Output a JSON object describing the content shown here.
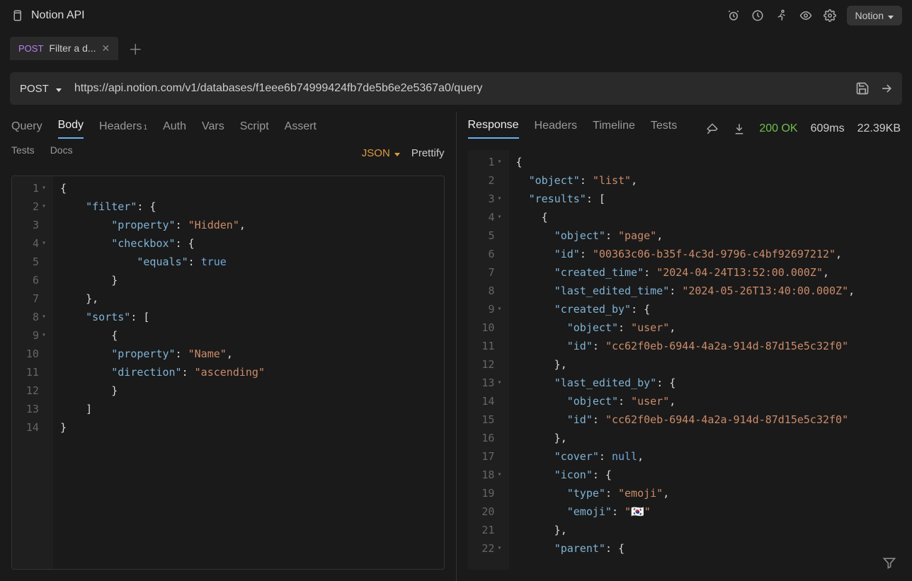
{
  "titlebar": {
    "title": "Notion API",
    "env_label": "Notion"
  },
  "tab": {
    "method": "POST",
    "label": "Filter a d..."
  },
  "request": {
    "method": "POST",
    "url": "https://api.notion.com/v1/databases/f1eee6b74999424fb7de5b6e2e5367a0/query"
  },
  "left_tabs": {
    "query": "Query",
    "body": "Body",
    "headers": "Headers",
    "headers_badge": "1",
    "auth": "Auth",
    "vars": "Vars",
    "script": "Script",
    "assert": "Assert",
    "tests": "Tests",
    "docs": "Docs"
  },
  "format": {
    "json": "JSON",
    "prettify": "Prettify"
  },
  "right_tabs": {
    "response": "Response",
    "headers": "Headers",
    "timeline": "Timeline",
    "tests": "Tests"
  },
  "response_stats": {
    "status": "200 OK",
    "time": "609ms",
    "size": "22.39KB"
  },
  "request_body_lines": [
    {
      "n": "1",
      "fold": true,
      "tokens": [
        {
          "t": "p",
          "v": "{"
        }
      ]
    },
    {
      "n": "2",
      "fold": true,
      "tokens": [
        {
          "t": "p",
          "v": "    "
        },
        {
          "t": "k",
          "v": "\"filter\""
        },
        {
          "t": "p",
          "v": ": {"
        }
      ]
    },
    {
      "n": "3",
      "tokens": [
        {
          "t": "p",
          "v": "        "
        },
        {
          "t": "k",
          "v": "\"property\""
        },
        {
          "t": "p",
          "v": ": "
        },
        {
          "t": "s",
          "v": "\"Hidden\""
        },
        {
          "t": "p",
          "v": ","
        }
      ]
    },
    {
      "n": "4",
      "fold": true,
      "tokens": [
        {
          "t": "p",
          "v": "        "
        },
        {
          "t": "k",
          "v": "\"checkbox\""
        },
        {
          "t": "p",
          "v": ": {"
        }
      ]
    },
    {
      "n": "5",
      "tokens": [
        {
          "t": "p",
          "v": "            "
        },
        {
          "t": "k",
          "v": "\"equals\""
        },
        {
          "t": "p",
          "v": ": "
        },
        {
          "t": "b",
          "v": "true"
        }
      ]
    },
    {
      "n": "6",
      "tokens": [
        {
          "t": "p",
          "v": "        }"
        }
      ]
    },
    {
      "n": "7",
      "tokens": [
        {
          "t": "p",
          "v": "    },"
        }
      ]
    },
    {
      "n": "8",
      "fold": true,
      "tokens": [
        {
          "t": "p",
          "v": "    "
        },
        {
          "t": "k",
          "v": "\"sorts\""
        },
        {
          "t": "p",
          "v": ": ["
        }
      ]
    },
    {
      "n": "9",
      "fold": true,
      "tokens": [
        {
          "t": "p",
          "v": "        {"
        }
      ]
    },
    {
      "n": "10",
      "tokens": [
        {
          "t": "p",
          "v": "        "
        },
        {
          "t": "k",
          "v": "\"property\""
        },
        {
          "t": "p",
          "v": ": "
        },
        {
          "t": "s",
          "v": "\"Name\""
        },
        {
          "t": "p",
          "v": ","
        }
      ]
    },
    {
      "n": "11",
      "tokens": [
        {
          "t": "p",
          "v": "        "
        },
        {
          "t": "k",
          "v": "\"direction\""
        },
        {
          "t": "p",
          "v": ": "
        },
        {
          "t": "s",
          "v": "\"ascending\""
        }
      ]
    },
    {
      "n": "12",
      "tokens": [
        {
          "t": "p",
          "v": "        }"
        }
      ]
    },
    {
      "n": "13",
      "tokens": [
        {
          "t": "p",
          "v": "    ]"
        }
      ]
    },
    {
      "n": "14",
      "tokens": [
        {
          "t": "p",
          "v": "}"
        }
      ]
    }
  ],
  "response_body_lines": [
    {
      "n": "1",
      "fold": true,
      "tokens": [
        {
          "t": "p",
          "v": "{"
        }
      ]
    },
    {
      "n": "2",
      "tokens": [
        {
          "t": "p",
          "v": "  "
        },
        {
          "t": "k",
          "v": "\"object\""
        },
        {
          "t": "p",
          "v": ": "
        },
        {
          "t": "s",
          "v": "\"list\""
        },
        {
          "t": "p",
          "v": ","
        }
      ]
    },
    {
      "n": "3",
      "fold": true,
      "tokens": [
        {
          "t": "p",
          "v": "  "
        },
        {
          "t": "k",
          "v": "\"results\""
        },
        {
          "t": "p",
          "v": ": ["
        }
      ]
    },
    {
      "n": "4",
      "fold": true,
      "tokens": [
        {
          "t": "p",
          "v": "    {"
        }
      ]
    },
    {
      "n": "5",
      "tokens": [
        {
          "t": "p",
          "v": "      "
        },
        {
          "t": "k",
          "v": "\"object\""
        },
        {
          "t": "p",
          "v": ": "
        },
        {
          "t": "s",
          "v": "\"page\""
        },
        {
          "t": "p",
          "v": ","
        }
      ]
    },
    {
      "n": "6",
      "tokens": [
        {
          "t": "p",
          "v": "      "
        },
        {
          "t": "k",
          "v": "\"id\""
        },
        {
          "t": "p",
          "v": ": "
        },
        {
          "t": "s",
          "v": "\"00363c06-b35f-4c3d-9796-c4bf92697212\""
        },
        {
          "t": "p",
          "v": ","
        }
      ]
    },
    {
      "n": "7",
      "tokens": [
        {
          "t": "p",
          "v": "      "
        },
        {
          "t": "k",
          "v": "\"created_time\""
        },
        {
          "t": "p",
          "v": ": "
        },
        {
          "t": "s",
          "v": "\"2024-04-24T13:52:00.000Z\""
        },
        {
          "t": "p",
          "v": ","
        }
      ]
    },
    {
      "n": "8",
      "tokens": [
        {
          "t": "p",
          "v": "      "
        },
        {
          "t": "k",
          "v": "\"last_edited_time\""
        },
        {
          "t": "p",
          "v": ": "
        },
        {
          "t": "s",
          "v": "\"2024-05-26T13:40:00.000Z\""
        },
        {
          "t": "p",
          "v": ","
        }
      ]
    },
    {
      "n": "9",
      "fold": true,
      "tokens": [
        {
          "t": "p",
          "v": "      "
        },
        {
          "t": "k",
          "v": "\"created_by\""
        },
        {
          "t": "p",
          "v": ": {"
        }
      ]
    },
    {
      "n": "10",
      "tokens": [
        {
          "t": "p",
          "v": "        "
        },
        {
          "t": "k",
          "v": "\"object\""
        },
        {
          "t": "p",
          "v": ": "
        },
        {
          "t": "s",
          "v": "\"user\""
        },
        {
          "t": "p",
          "v": ","
        }
      ]
    },
    {
      "n": "11",
      "tokens": [
        {
          "t": "p",
          "v": "        "
        },
        {
          "t": "k",
          "v": "\"id\""
        },
        {
          "t": "p",
          "v": ": "
        },
        {
          "t": "s",
          "v": "\"cc62f0eb-6944-4a2a-914d-87d15e5c32f0\""
        }
      ]
    },
    {
      "n": "12",
      "tokens": [
        {
          "t": "p",
          "v": "      },"
        }
      ]
    },
    {
      "n": "13",
      "fold": true,
      "tokens": [
        {
          "t": "p",
          "v": "      "
        },
        {
          "t": "k",
          "v": "\"last_edited_by\""
        },
        {
          "t": "p",
          "v": ": {"
        }
      ]
    },
    {
      "n": "14",
      "tokens": [
        {
          "t": "p",
          "v": "        "
        },
        {
          "t": "k",
          "v": "\"object\""
        },
        {
          "t": "p",
          "v": ": "
        },
        {
          "t": "s",
          "v": "\"user\""
        },
        {
          "t": "p",
          "v": ","
        }
      ]
    },
    {
      "n": "15",
      "tokens": [
        {
          "t": "p",
          "v": "        "
        },
        {
          "t": "k",
          "v": "\"id\""
        },
        {
          "t": "p",
          "v": ": "
        },
        {
          "t": "s",
          "v": "\"cc62f0eb-6944-4a2a-914d-87d15e5c32f0\""
        }
      ]
    },
    {
      "n": "16",
      "tokens": [
        {
          "t": "p",
          "v": "      },"
        }
      ]
    },
    {
      "n": "17",
      "tokens": [
        {
          "t": "p",
          "v": "      "
        },
        {
          "t": "k",
          "v": "\"cover\""
        },
        {
          "t": "p",
          "v": ": "
        },
        {
          "t": "b",
          "v": "null"
        },
        {
          "t": "p",
          "v": ","
        }
      ]
    },
    {
      "n": "18",
      "fold": true,
      "tokens": [
        {
          "t": "p",
          "v": "      "
        },
        {
          "t": "k",
          "v": "\"icon\""
        },
        {
          "t": "p",
          "v": ": {"
        }
      ]
    },
    {
      "n": "19",
      "tokens": [
        {
          "t": "p",
          "v": "        "
        },
        {
          "t": "k",
          "v": "\"type\""
        },
        {
          "t": "p",
          "v": ": "
        },
        {
          "t": "s",
          "v": "\"emoji\""
        },
        {
          "t": "p",
          "v": ","
        }
      ]
    },
    {
      "n": "20",
      "tokens": [
        {
          "t": "p",
          "v": "        "
        },
        {
          "t": "k",
          "v": "\"emoji\""
        },
        {
          "t": "p",
          "v": ": "
        },
        {
          "t": "s",
          "v": "\"🇰🇷\""
        }
      ]
    },
    {
      "n": "21",
      "tokens": [
        {
          "t": "p",
          "v": "      },"
        }
      ]
    },
    {
      "n": "22",
      "fold": true,
      "tokens": [
        {
          "t": "p",
          "v": "      "
        },
        {
          "t": "k",
          "v": "\"parent\""
        },
        {
          "t": "p",
          "v": ": {"
        }
      ]
    }
  ]
}
